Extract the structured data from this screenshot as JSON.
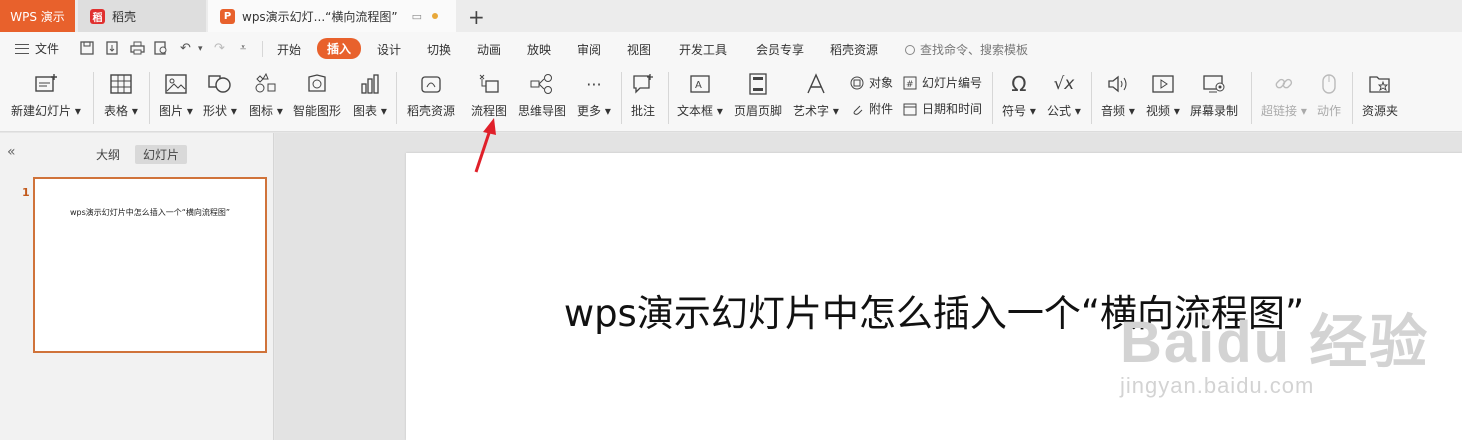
{
  "tabbar": {
    "app_label": "WPS 演示",
    "tabs": [
      {
        "label": "稻壳",
        "badge": "稻"
      },
      {
        "label": "wps演示幻灯...“横向流程图”",
        "badge": "P"
      }
    ],
    "add_label": "+"
  },
  "menubar": {
    "file_label": "文件",
    "items": [
      "开始",
      "插入",
      "设计",
      "切换",
      "动画",
      "放映",
      "审阅",
      "视图",
      "开发工具",
      "会员专享",
      "稻壳资源"
    ],
    "active": "插入",
    "search_placeholder": "查找命令、搜索模板"
  },
  "ribbon": {
    "new_slide": "新建幻灯片",
    "table": "表格",
    "picture": "图片",
    "shape": "形状",
    "icon": "图标",
    "smartart": "智能图形",
    "chart": "图表",
    "docer": "稻壳资源",
    "flowchart": "流程图",
    "mindmap": "思维导图",
    "more": "更多",
    "comment": "批注",
    "textbox": "文本框",
    "header_footer": "页眉页脚",
    "wordart": "艺术字",
    "object": "对象",
    "attachment": "附件",
    "slide_number": "幻灯片编号",
    "datetime": "日期和时间",
    "symbol": "符号",
    "formula": "公式",
    "audio": "音频",
    "video": "视频",
    "screen_record": "屏幕录制",
    "hyperlink": "超链接",
    "action": "动作",
    "resource_folder": "资源夹"
  },
  "leftpane": {
    "collapse": "«",
    "tab_outline": "大纲",
    "tab_slides": "幻灯片",
    "slide_number": "1",
    "thumb_title": "wps演示幻灯片中怎么插入一个“横向流程图”"
  },
  "slide": {
    "title": "wps演示幻灯片中怎么插入一个“横向流程图”"
  },
  "watermark": {
    "main": "Baidu 经验",
    "sub": "jingyan.baidu.com"
  },
  "colors": {
    "accent": "#e8612c",
    "arrow": "#e0202a"
  }
}
